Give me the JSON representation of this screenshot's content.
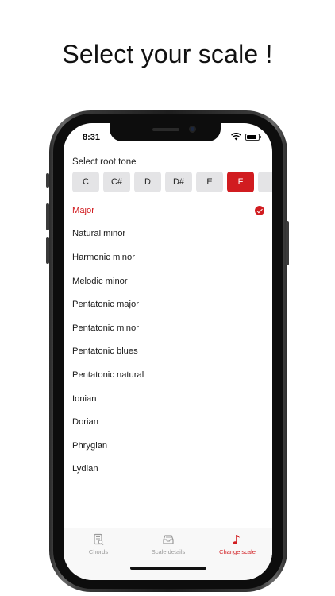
{
  "headline": "Select your scale !",
  "status_bar": {
    "time": "8:31"
  },
  "root_tone": {
    "label": "Select root tone",
    "tones": [
      "C",
      "C#",
      "D",
      "D#",
      "E",
      "F"
    ],
    "selected": "F"
  },
  "scales": [
    {
      "name": "Major",
      "selected": true
    },
    {
      "name": "Natural minor"
    },
    {
      "name": "Harmonic minor"
    },
    {
      "name": "Melodic minor"
    },
    {
      "name": "Pentatonic major"
    },
    {
      "name": "Pentatonic minor"
    },
    {
      "name": "Pentatonic blues"
    },
    {
      "name": "Pentatonic natural"
    },
    {
      "name": "Ionian"
    },
    {
      "name": "Dorian"
    },
    {
      "name": "Phrygian"
    },
    {
      "name": "Lydian"
    }
  ],
  "tabbar": {
    "tabs": [
      {
        "label": "Chords",
        "icon": "chord-sheet-icon"
      },
      {
        "label": "Scale details",
        "icon": "tray-icon"
      },
      {
        "label": "Change scale",
        "icon": "music-note-icon",
        "active": true
      }
    ]
  },
  "colors": {
    "accent": "#d11c20",
    "tone_bg": "#e4e4e6",
    "tab_inactive": "#9a9a9a"
  }
}
